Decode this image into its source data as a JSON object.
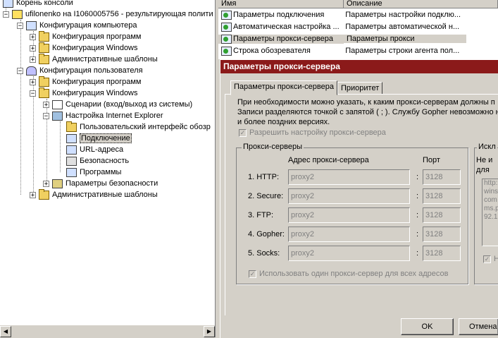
{
  "tree": {
    "items": [
      {
        "label": "Корень консоли"
      },
      {
        "label": "ufilonenko на I1060005756 - результирующая полити"
      },
      {
        "label": "Конфигурация компьютера"
      },
      {
        "label": "Конфигурация программ"
      },
      {
        "label": "Конфигурация Windows"
      },
      {
        "label": "Административные шаблоны"
      },
      {
        "label": "Конфигурация пользователя"
      },
      {
        "label": "Конфигурация программ"
      },
      {
        "label": "Конфигурация Windows"
      },
      {
        "label": "Сценарии (вход/выход из системы)"
      },
      {
        "label": "Настройка Internet Explorer"
      },
      {
        "label": "Пользовательский интерфейс обозр"
      },
      {
        "label": "Подключение"
      },
      {
        "label": "URL-адреса"
      },
      {
        "label": "Безопасность"
      },
      {
        "label": "Программы"
      },
      {
        "label": "Параметры безопасности"
      },
      {
        "label": "Административные шаблоны"
      }
    ],
    "toggles": {
      "plus": "+",
      "minus": "−"
    }
  },
  "list": {
    "columns": [
      "Имя",
      "Описание"
    ],
    "rows": [
      {
        "name": "Параметры подключения",
        "desc": "Параметры настройки подклю..."
      },
      {
        "name": "Автоматическая настройка ...",
        "desc": "Параметры автоматической н..."
      },
      {
        "name": "Параметры прокси-сервера",
        "desc": "Параметры прокси"
      },
      {
        "name": "Строка обозревателя",
        "desc": "Параметры строки агента пол..."
      }
    ]
  },
  "dialog": {
    "title": "Параметры прокси-сервера",
    "tabs": [
      "Параметры прокси-сервера",
      "Приоритет"
    ],
    "description": [
      "При необходимости можно указать, к каким прокси-серверам должны п",
      "Записи разделяются точкой с запятой ( ; ). Службу Gopher невозможно н",
      "и более поздних версиях."
    ],
    "allow_setting": "Разрешить настройку прокси-сервера",
    "proxy_group_label": "Прокси-серверы",
    "address_header": "Адрес прокси-сервера",
    "port_header": "Порт",
    "proxies": [
      {
        "label": "1. HTTP:",
        "address": "proxy2",
        "port": "3128"
      },
      {
        "label": "2. Secure:",
        "address": "proxy2",
        "port": "3128"
      },
      {
        "label": "3. FTP:",
        "address": "proxy2",
        "port": "3128"
      },
      {
        "label": "4. Gopher:",
        "address": "proxy2",
        "port": "3128"
      },
      {
        "label": "5. Socks:",
        "address": "proxy2",
        "port": "3128"
      }
    ],
    "same_proxy": "Использовать один прокси-сервер для всех адресов",
    "exceptions_label": "Искл",
    "exceptions_hint": [
      "Не и",
      "для"
    ],
    "exceptions_text": [
      "http:",
      "wins",
      "com",
      "ms.p",
      "92.1"
    ],
    "exceptions_check_label": "Н",
    "ok": "OK",
    "cancel": "Отмена",
    "colon": ":",
    "checkmark": "✓"
  }
}
